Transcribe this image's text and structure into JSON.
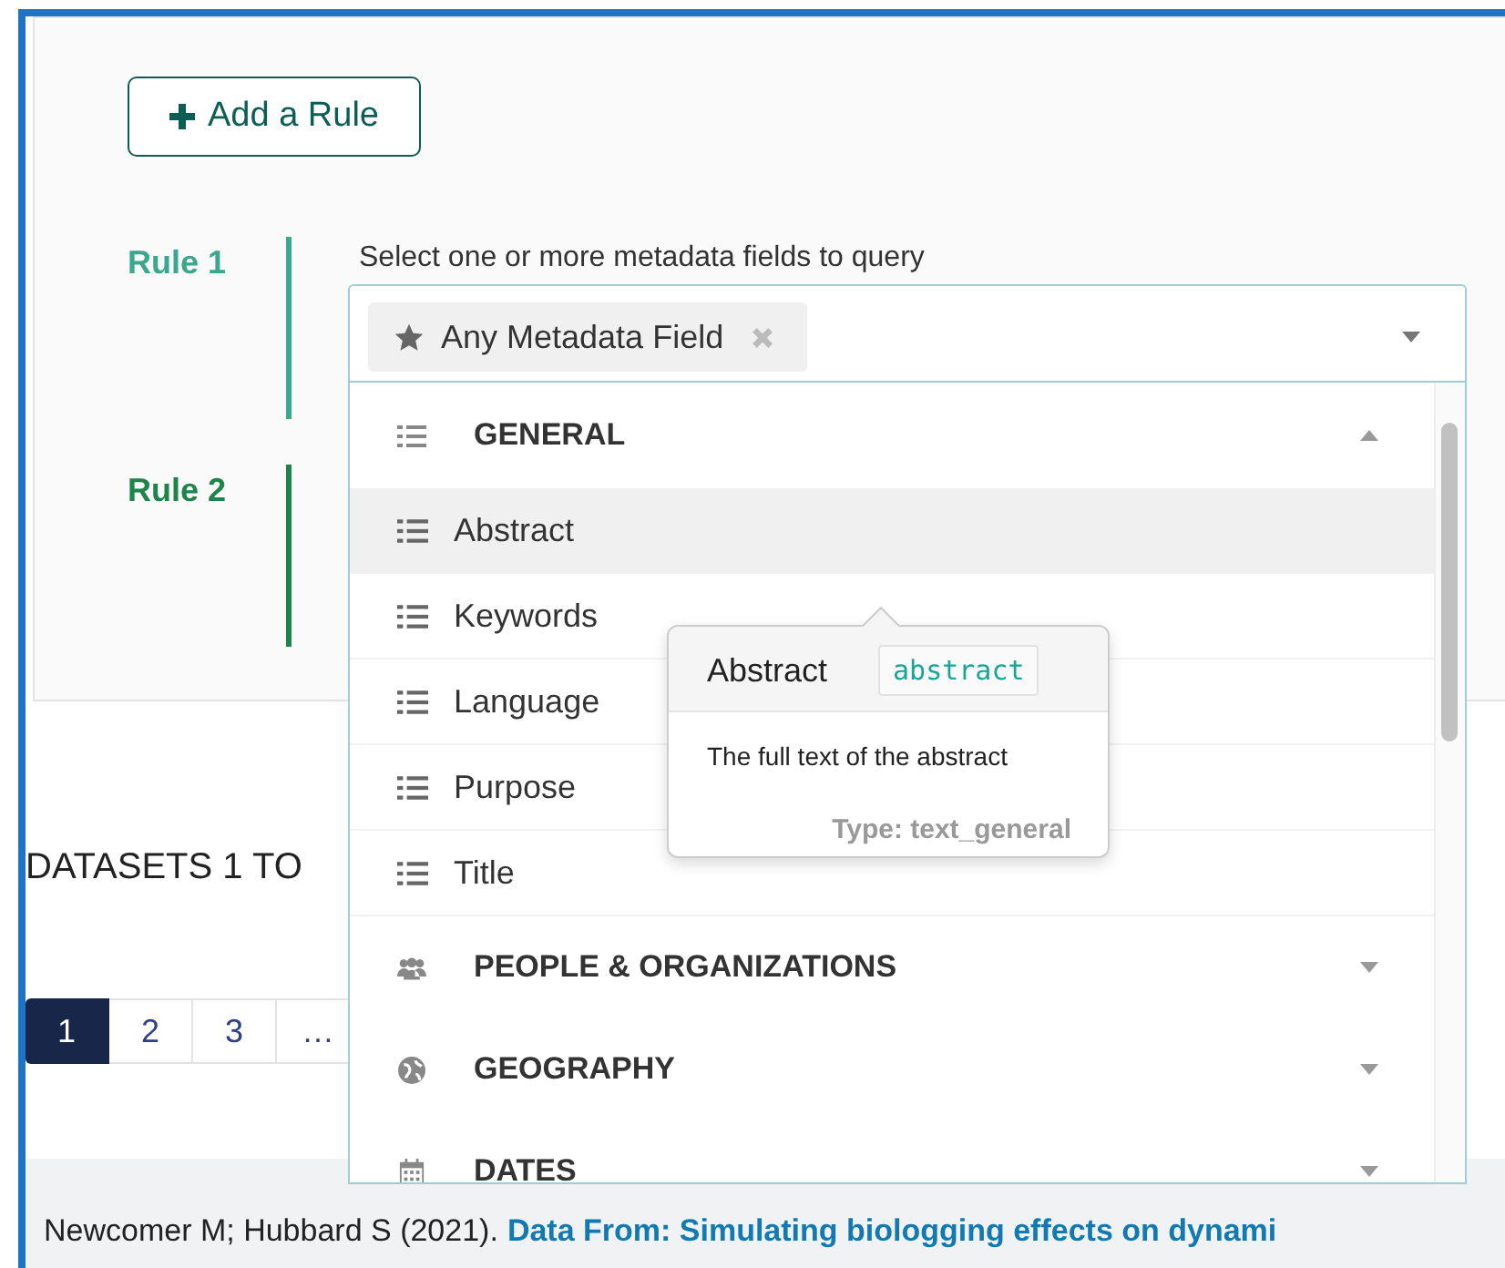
{
  "add_rule_button": {
    "label": "Add a Rule"
  },
  "rules": [
    {
      "label": "Rule 1",
      "color": "#3ba88e"
    },
    {
      "label": "Rule 2",
      "color": "#1e8449"
    }
  ],
  "field_prompt": "Select one or more metadata fields to query",
  "field_select": {
    "chip": "Any Metadata Field",
    "groups": [
      {
        "label": "GENERAL",
        "expanded": true,
        "children": [
          {
            "label": "Abstract",
            "selected": true
          },
          {
            "label": "Keywords",
            "selected": false
          },
          {
            "label": "Language",
            "selected": false
          },
          {
            "label": "Purpose",
            "selected": false
          },
          {
            "label": "Title",
            "selected": false
          }
        ]
      },
      {
        "label": "PEOPLE & ORGANIZATIONS",
        "expanded": false
      },
      {
        "label": "GEOGRAPHY",
        "expanded": false
      },
      {
        "label": "DATES",
        "expanded": false
      }
    ]
  },
  "tooltip": {
    "title": "Abstract",
    "code": "abstract",
    "description": "The full text of the abstract",
    "type": "Type: text_general"
  },
  "results_heading": "DATASETS 1 TO",
  "pagination": [
    {
      "label": "1",
      "selected": true
    },
    {
      "label": "2",
      "selected": false
    },
    {
      "label": "3",
      "selected": false
    },
    {
      "label": "…",
      "selected": false
    }
  ],
  "result": {
    "authors": "Newcomer M; Hubbard S (2021).",
    "title": "Data From: Simulating biologging effects on dynami"
  }
}
